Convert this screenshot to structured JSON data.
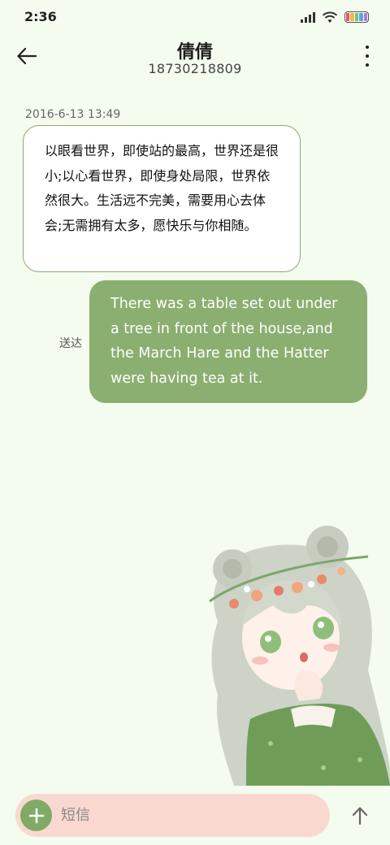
{
  "status_bar": {
    "time": "2:36",
    "icons": [
      "signal-icon",
      "wifi-icon",
      "battery-icon"
    ],
    "battery_colors": [
      "#e5566a",
      "#f0b84a",
      "#6fc86a",
      "#5aa4e8",
      "#b07ad8"
    ]
  },
  "header": {
    "contact_name": "倩倩",
    "contact_number": "18730218809",
    "back_icon": "back-arrow-icon",
    "menu_icon": "more-vertical-icon"
  },
  "conversation": {
    "timestamp": "2016-6-13 13:49",
    "incoming": {
      "text": "以眼看世界，即使站的最高，世界还是很小;以心看世界，即使身处局限，世界依然很大。生活远不完美，需要用心去体会;无需拥有太多，愿快乐与你相随。"
    },
    "outgoing": {
      "text": "There was a table set out under a tree in front of the house,and the March Hare and the Hatter were having tea at it.",
      "status": "送达"
    }
  },
  "composer": {
    "placeholder": "短信",
    "add_icon": "plus-icon",
    "send_icon": "send-arrow-icon"
  },
  "colors": {
    "background": "#f4fbef",
    "incoming_border": "#8aab72",
    "outgoing_bubble": "#8aaf70",
    "composer_pill": "#f9d9cf",
    "add_button": "#7fab66"
  }
}
